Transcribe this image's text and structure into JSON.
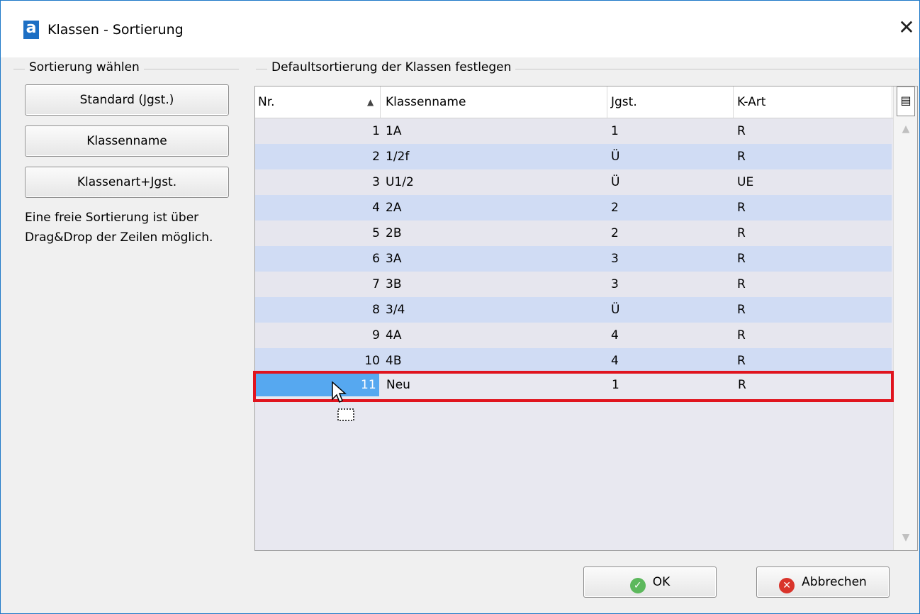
{
  "window": {
    "app_icon": "a",
    "title": "Klassen - Sortierung",
    "close_glyph": "✕"
  },
  "left": {
    "group_title": "Sortierung wählen",
    "buttons": [
      "Standard (Jgst.)",
      "Klassenname",
      "Klassenart+Jgst."
    ],
    "hint": "Eine freie Sortierung ist über Drag&Drop der Zeilen möglich."
  },
  "right": {
    "group_title": "Defaultsortierung der Klassen festlegen",
    "columns": {
      "nr": "Nr.",
      "name": "Klassenname",
      "jgst": "Jgst.",
      "kart": "K-Art"
    },
    "sort_indicator": "▲",
    "rows": [
      {
        "nr": "1",
        "name": "1A",
        "jgst": "1",
        "kart": "R"
      },
      {
        "nr": "2",
        "name": "1/2f",
        "jgst": "Ü",
        "kart": "R"
      },
      {
        "nr": "3",
        "name": "U1/2",
        "jgst": "Ü",
        "kart": "UE"
      },
      {
        "nr": "4",
        "name": "2A",
        "jgst": "2",
        "kart": "R"
      },
      {
        "nr": "5",
        "name": "2B",
        "jgst": "2",
        "kart": "R"
      },
      {
        "nr": "6",
        "name": "3A",
        "jgst": "3",
        "kart": "R"
      },
      {
        "nr": "7",
        "name": "3B",
        "jgst": "3",
        "kart": "R"
      },
      {
        "nr": "8",
        "name": "3/4",
        "jgst": "Ü",
        "kart": "R"
      },
      {
        "nr": "9",
        "name": "4A",
        "jgst": "4",
        "kart": "R"
      },
      {
        "nr": "10",
        "name": "4B",
        "jgst": "4",
        "kart": "R"
      }
    ],
    "dragged_row": {
      "nr": "11",
      "name": "Neu",
      "jgst": "1",
      "kart": "R"
    }
  },
  "footer": {
    "ok_label": "OK",
    "cancel_label": "Abbrechen"
  },
  "colors": {
    "highlight": "#e0141e",
    "selection": "#56a8f0",
    "row_alt": "#d0dcf4"
  }
}
